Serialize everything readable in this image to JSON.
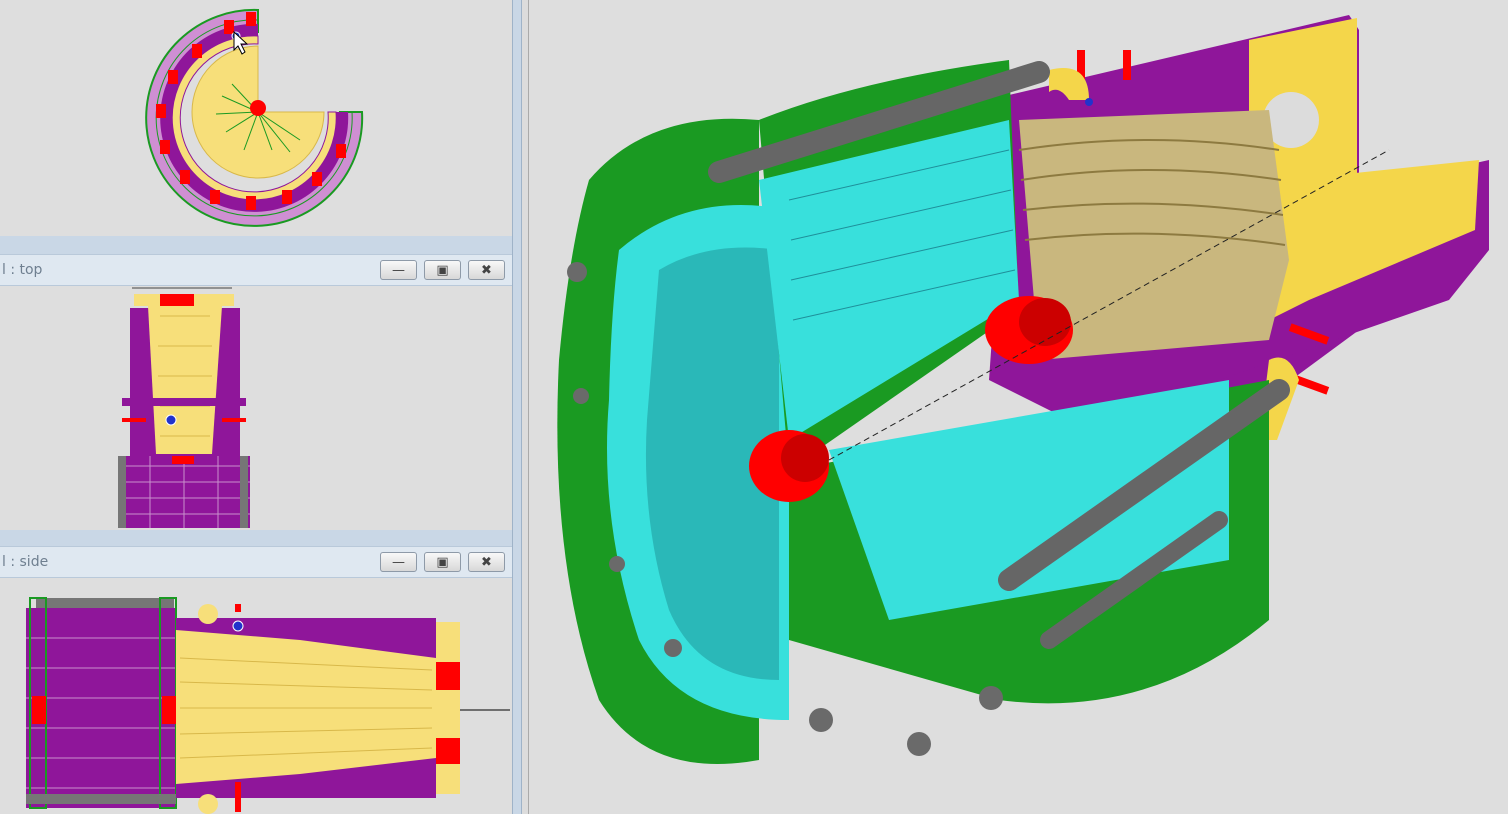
{
  "panels": {
    "top": {
      "title": "l : top"
    },
    "side": {
      "title": "l : side"
    }
  },
  "window_controls": {
    "minimize_icon": "minimize-icon",
    "maximize_icon": "maximize-icon",
    "close_icon": "close-icon"
  },
  "colors": {
    "yellow": "#f7df7a",
    "purple": "#8f169a",
    "green": "#1a9a22",
    "red": "#ff0000",
    "cyan": "#38e0dc",
    "gray": "#767676",
    "background": "#dcdcdc"
  }
}
